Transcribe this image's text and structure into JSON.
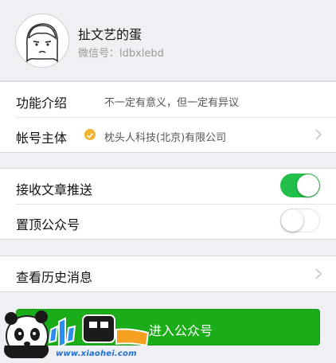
{
  "profile": {
    "name": "扯文艺的蛋",
    "wechat_id": "微信号：ldbxlebd"
  },
  "info": {
    "intro_label": "功能介绍",
    "intro_value": "不一定有意义，但一定有异议",
    "owner_label": "帐号主体",
    "owner_value": "枕头人科技(北京)有限公司"
  },
  "settings": {
    "receive_label": "接收文章推送",
    "receive_on": true,
    "pin_label": "置顶公众号",
    "pin_on": false
  },
  "history": {
    "label": "查看历史消息"
  },
  "enter_button": {
    "label": "进入公众号"
  },
  "watermark": {
    "url": "www.xiaohei.com"
  },
  "colors": {
    "accent_green": "#1aad19",
    "toggle_green": "#22c04b",
    "verified_orange": "#f3b333"
  },
  "icons": [
    "avatar-illustration",
    "verified-badge-icon",
    "chevron-right-icon",
    "panda-watermark-icon"
  ]
}
